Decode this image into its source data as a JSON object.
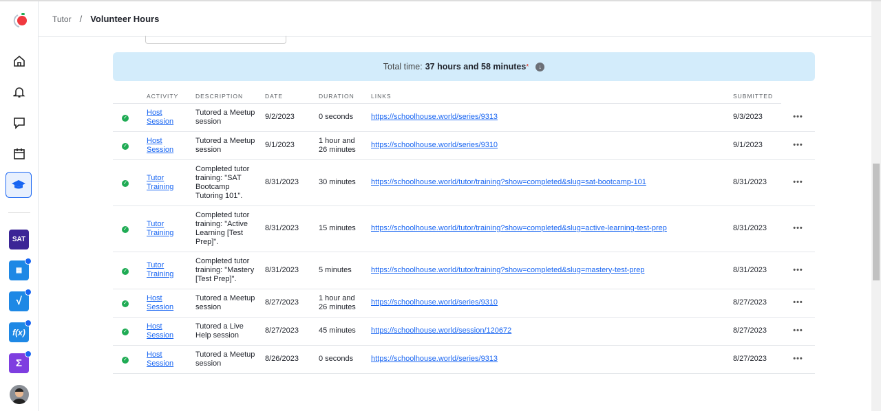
{
  "sidebar": {
    "apps": [
      {
        "name": "sat",
        "label": "SAT",
        "color": "#3b2596"
      },
      {
        "name": "calculator-app",
        "color": "#1e88e5"
      },
      {
        "name": "sqrt-app",
        "color": "#1e88e5"
      },
      {
        "name": "function-app",
        "color": "#1e88e5"
      },
      {
        "name": "sigma-app",
        "color": "#7e3ee0"
      }
    ]
  },
  "breadcrumb": {
    "parent": "Tutor",
    "separator": "/",
    "current": "Volunteer Hours"
  },
  "total": {
    "label": "Total time:",
    "value": "37 hours and 58 minutes",
    "asterisk": "*"
  },
  "table": {
    "headers": [
      "ACTIVITY",
      "DESCRIPTION",
      "DATE",
      "DURATION",
      "LINKS",
      "SUBMITTED"
    ],
    "rows": [
      {
        "activity": "Host Session",
        "description": "Tutored a Meetup session",
        "date": "9/2/2023",
        "duration": "0 seconds",
        "link": "https://schoolhouse.world/series/9313",
        "submitted": "9/3/2023"
      },
      {
        "activity": "Host Session",
        "description": "Tutored a Meetup session",
        "date": "9/1/2023",
        "duration": "1 hour and 26 minutes",
        "link": "https://schoolhouse.world/series/9310",
        "submitted": "9/1/2023"
      },
      {
        "activity": "Tutor Training",
        "description": "Completed tutor training: \"SAT Bootcamp Tutoring 101\".",
        "date": "8/31/2023",
        "duration": "30 minutes",
        "link": "https://schoolhouse.world/tutor/training?show=completed&slug=sat-bootcamp-101",
        "submitted": "8/31/2023"
      },
      {
        "activity": "Tutor Training",
        "description": "Completed tutor training: \"Active Learning [Test Prep]\".",
        "date": "8/31/2023",
        "duration": "15 minutes",
        "link": "https://schoolhouse.world/tutor/training?show=completed&slug=active-learning-test-prep",
        "submitted": "8/31/2023"
      },
      {
        "activity": "Tutor Training",
        "description": "Completed tutor training: \"Mastery [Test Prep]\".",
        "date": "8/31/2023",
        "duration": "5 minutes",
        "link": "https://schoolhouse.world/tutor/training?show=completed&slug=mastery-test-prep",
        "submitted": "8/31/2023"
      },
      {
        "activity": "Host Session",
        "description": "Tutored a Meetup session",
        "date": "8/27/2023",
        "duration": "1 hour and 26 minutes",
        "link": "https://schoolhouse.world/series/9310",
        "submitted": "8/27/2023"
      },
      {
        "activity": "Host Session",
        "description": "Tutored a Live Help session",
        "date": "8/27/2023",
        "duration": "45 minutes",
        "link": "https://schoolhouse.world/session/120672",
        "submitted": "8/27/2023"
      },
      {
        "activity": "Host Session",
        "description": "Tutored a Meetup session",
        "date": "8/26/2023",
        "duration": "0 seconds",
        "link": "https://schoolhouse.world/series/9313",
        "submitted": "8/27/2023"
      }
    ]
  }
}
